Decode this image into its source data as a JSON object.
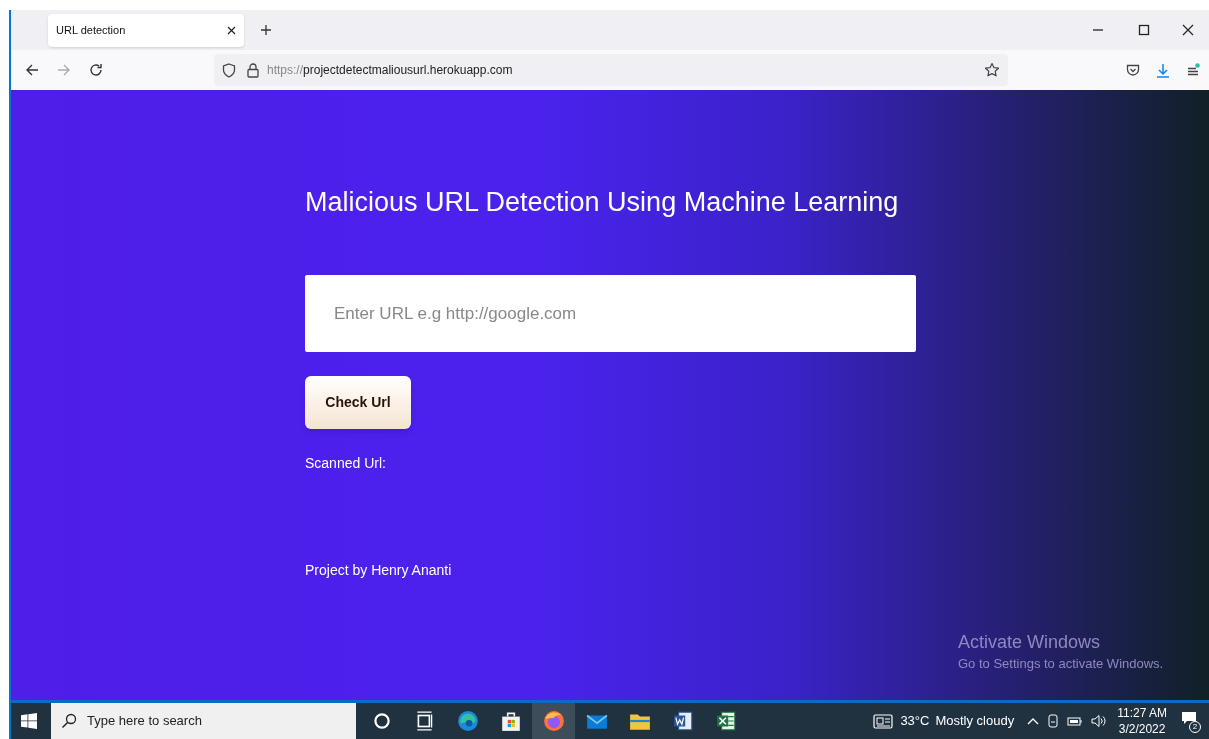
{
  "browser": {
    "tabs": [
      {
        "title": "URL detection",
        "selected": true
      }
    ],
    "address": {
      "scheme": "https://",
      "host": "projectdetectmaliousurl.herokuapp.com"
    }
  },
  "page": {
    "heading": "Malicious URL Detection Using Machine Learning",
    "url_field": {
      "placeholder": "Enter URL e.g http://google.com"
    },
    "check_button": "Check Url",
    "scanned_label": "Scanned Url:",
    "footer": "Project by Henry Ananti"
  },
  "activation_notice": {
    "title": "Activate Windows",
    "message": "Go to Settings to activate Windows."
  },
  "taskbar": {
    "search_placeholder": "Type here to search",
    "apps": [
      {
        "kind": "cortana",
        "selected": false
      },
      {
        "kind": "taskview",
        "selected": false
      },
      {
        "kind": "edge",
        "selected": false
      },
      {
        "kind": "store",
        "selected": false
      },
      {
        "kind": "firefox",
        "selected": true
      },
      {
        "kind": "mail",
        "selected": false
      },
      {
        "kind": "files",
        "selected": false
      },
      {
        "kind": "word",
        "selected": false
      },
      {
        "kind": "excel",
        "selected": false
      }
    ],
    "weather": {
      "temperature": "33°C",
      "condition": "Mostly cloudy"
    },
    "time": "11:27 AM",
    "date": "3/2/2022",
    "notification_count": "2"
  }
}
